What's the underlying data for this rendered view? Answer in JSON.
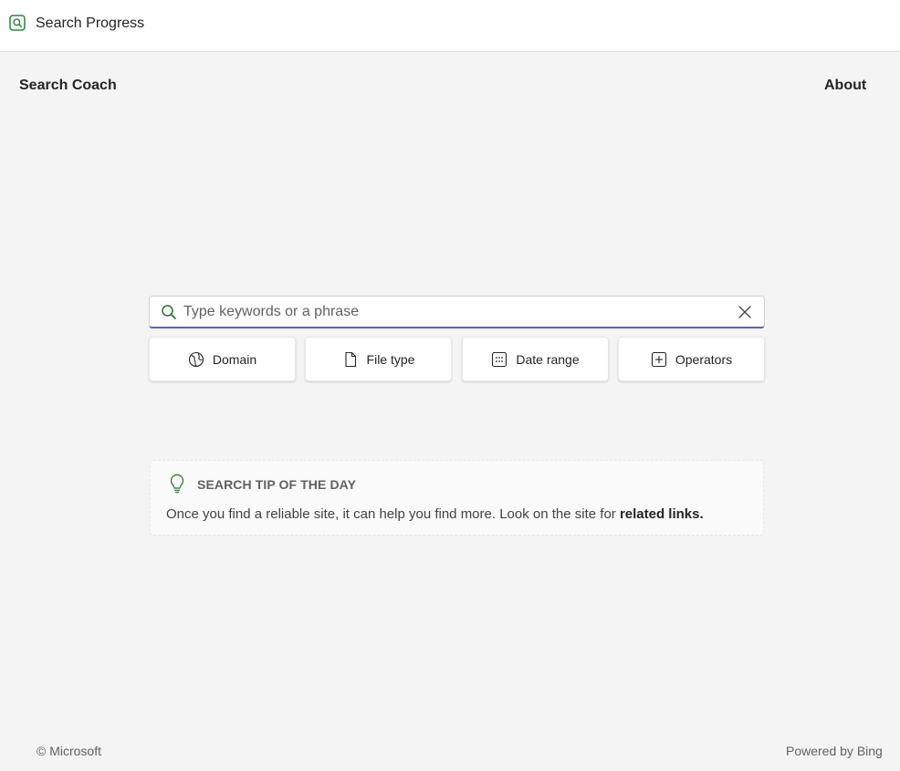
{
  "app": {
    "title": "Search Progress",
    "icon": "search-app-icon",
    "accent_color": "#2e8b3e"
  },
  "nav": {
    "left_label": "Search Coach",
    "right_label": "About"
  },
  "search": {
    "value": "",
    "placeholder": "Type keywords or a phrase",
    "underline_color": "#5b5fc7",
    "search_icon": "search-icon",
    "clear_icon": "close-icon"
  },
  "filters": [
    {
      "label": "Domain",
      "icon": "globe-icon"
    },
    {
      "label": "File type",
      "icon": "document-icon"
    },
    {
      "label": "Date range",
      "icon": "calendar-icon"
    },
    {
      "label": "Operators",
      "icon": "plus-square-icon"
    }
  ],
  "tip": {
    "icon": "lightbulb-icon",
    "title": "SEARCH TIP OF THE DAY",
    "text": "Once you find a reliable site, it can help you find more. Look on the site for ",
    "emphasis": "related links."
  },
  "footer": {
    "copyright": "© Microsoft",
    "powered_by": "Powered by Bing"
  }
}
